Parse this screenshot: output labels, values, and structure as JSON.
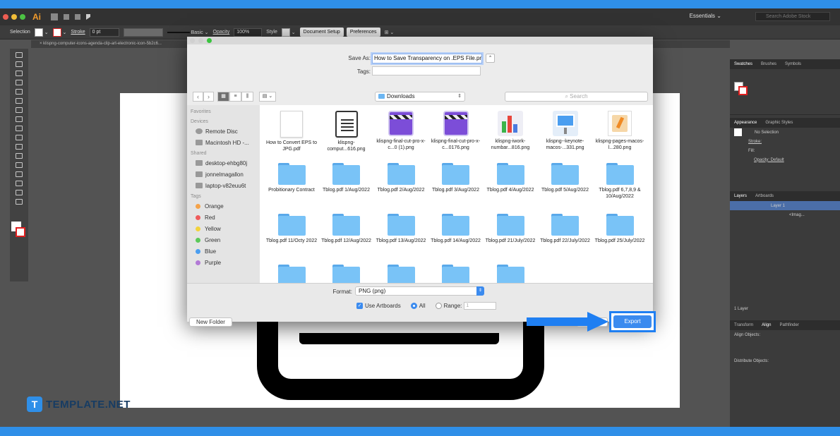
{
  "app": {
    "logo": "Ai",
    "workspace": "Essentials",
    "stock_search_placeholder": "Search Adobe Stock"
  },
  "controlbar": {
    "selection_label": "Selection",
    "stroke_label": "Stroke",
    "stroke_value": "0 pt",
    "brush_label": "Basic",
    "opacity_label": "Opacity",
    "opacity_value": "100%",
    "style_label": "Style",
    "document_setup": "Document Setup",
    "preferences": "Preferences"
  },
  "doc_tab": "klispng-computer-icons-agenda-clip-art-electronic-icon-5b2c6...",
  "dialog": {
    "save_as_label": "Save As:",
    "save_as_value": "How to Save Transparency on .EPS File.png",
    "tags_label": "Tags:",
    "location": "Downloads",
    "search_placeholder": "Search",
    "sidebar": {
      "favorites_head": "Favorites",
      "devices_head": "Devices",
      "devices": [
        "Remote Disc",
        "Macintosh HD -..."
      ],
      "shared_head": "Shared",
      "shared": [
        "desktop-ehbg80j",
        "jonnelmagallon",
        "laptop-v82euu6t"
      ],
      "tags_head": "Tags",
      "tags": [
        {
          "label": "Orange",
          "color": "#f5a34a"
        },
        {
          "label": "Red",
          "color": "#ef5b5b"
        },
        {
          "label": "Yellow",
          "color": "#f2d33c"
        },
        {
          "label": "Green",
          "color": "#5cc95a"
        },
        {
          "label": "Blue",
          "color": "#4a9ef0"
        },
        {
          "label": "Purple",
          "color": "#b27ad6"
        }
      ]
    },
    "files": [
      {
        "name": "How to Convert EPS to JPG.pdf",
        "icon": "pdf"
      },
      {
        "name": "klispng-comput...616.png",
        "icon": "document"
      },
      {
        "name": "klispng-final-cut-pro-x-c...0 (1).png",
        "icon": "clapper"
      },
      {
        "name": "klispng-final-cut-pro-x-c...0176.png",
        "icon": "clapper"
      },
      {
        "name": "klispng-iwork-numbar...816.png",
        "icon": "numbers"
      },
      {
        "name": "klispng--keynote-macos-...331.png",
        "icon": "keynote"
      },
      {
        "name": "klispng-pages-macos-l...280.png",
        "icon": "pages"
      },
      {
        "name": "Probitionary Contract",
        "icon": "folder"
      },
      {
        "name": "Tblog.pdf 1/Aug/2022",
        "icon": "folder"
      },
      {
        "name": "Tblog.pdf 2/Aug/2022",
        "icon": "folder"
      },
      {
        "name": "Tblog.pdf 3/Aug/2022",
        "icon": "folder"
      },
      {
        "name": "Tblog.pdf 4/Aug/2022",
        "icon": "folder"
      },
      {
        "name": "Tblog.pdf 5/Aug/2022",
        "icon": "folder"
      },
      {
        "name": "Tblog.pdf 6,7,8,9 & 10/Aug/2022",
        "icon": "folder"
      },
      {
        "name": "Tblog.pdf 11/Octy 2022",
        "icon": "folder"
      },
      {
        "name": "Tblog.pdf 12/Aug/2022",
        "icon": "folder"
      },
      {
        "name": "Tblog.pdf 13/Aug/2022",
        "icon": "folder"
      },
      {
        "name": "Tblog.pdf 14/Aug/2022",
        "icon": "folder"
      },
      {
        "name": "Tblog.pdf 21/July/2022",
        "icon": "folder"
      },
      {
        "name": "Tblog.pdf 22/July/2022",
        "icon": "folder"
      },
      {
        "name": "Tblog.pdf 25/July/2022",
        "icon": "folder"
      },
      {
        "name": "",
        "icon": "folder"
      },
      {
        "name": "",
        "icon": "folder"
      },
      {
        "name": "",
        "icon": "folder"
      },
      {
        "name": "",
        "icon": "folder"
      },
      {
        "name": "",
        "icon": "folder"
      }
    ],
    "format_label": "Format:",
    "format_value": "PNG (png)",
    "use_artboards_label": "Use Artboards",
    "all_label": "All",
    "range_label": "Range:",
    "range_value": "1",
    "new_folder": "New Folder",
    "export": "Export"
  },
  "panels": {
    "tabs_top": [
      "Swatches",
      "Brushes",
      "Symbols"
    ],
    "tabs_appearance": [
      "Appearance",
      "Graphic Styles"
    ],
    "no_selection": "No Selection",
    "stroke": "Stroke:",
    "fill": "Fill:",
    "opacity": "Opacity: Default",
    "tabs_layers": [
      "Layers",
      "Artboards"
    ],
    "layer_name": "Layer 1",
    "sublayer_name": "<Imag...",
    "layer_count": "1 Layer",
    "tabs_align": [
      "Transform",
      "Align",
      "Pathfinder"
    ],
    "align_objects": "Align Objects:",
    "distribute_objects": "Distribute Objects:"
  },
  "brand": {
    "badge": "T",
    "name": "TEMPLATE.NET"
  },
  "colors": {
    "accent": "#3b8bef",
    "highlight": "#1f7ff2",
    "page_border": "#2f8fe8"
  }
}
